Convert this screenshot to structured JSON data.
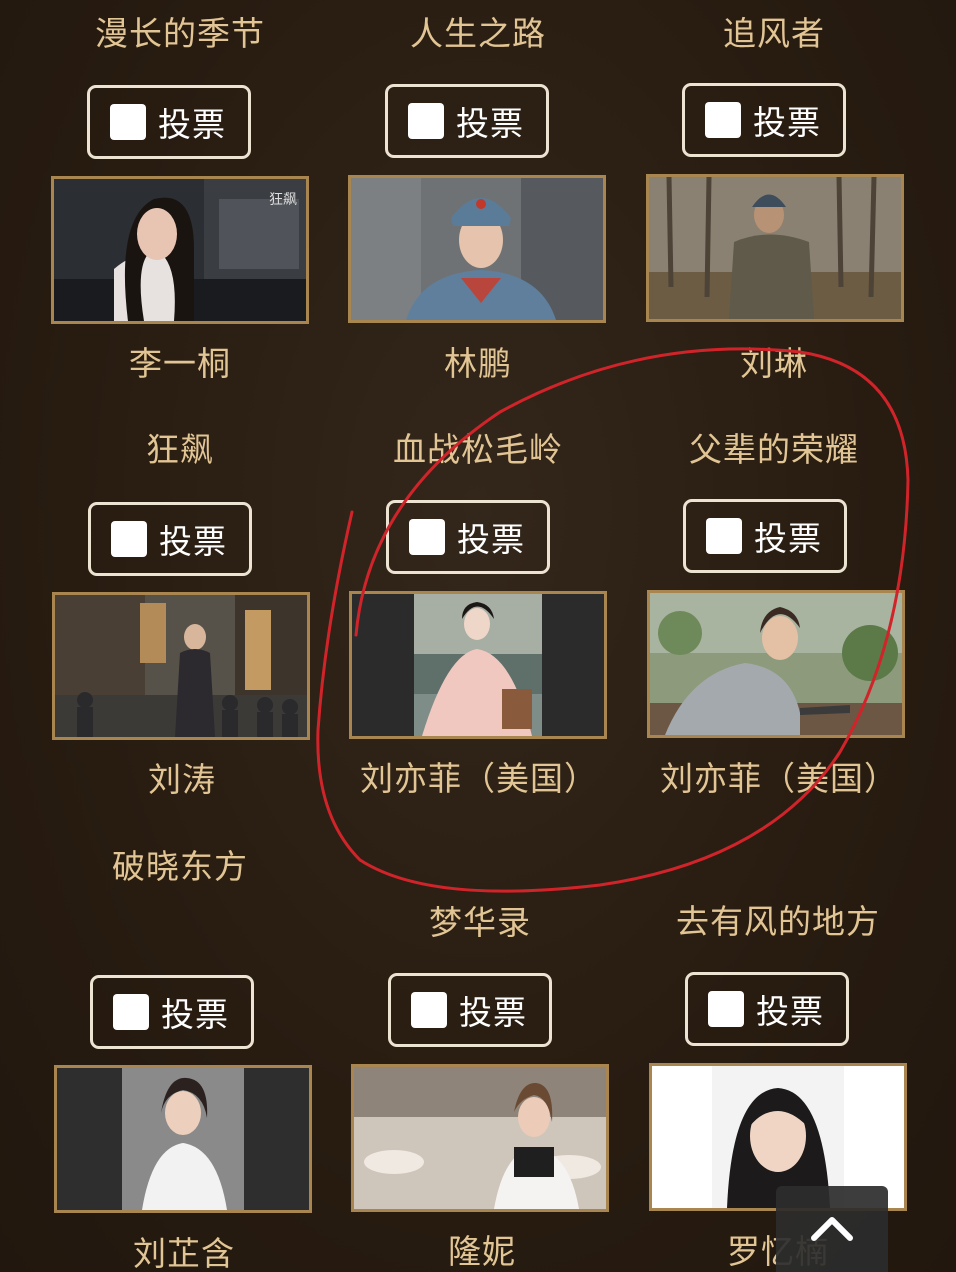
{
  "vote_label": "投票",
  "rows": [
    {
      "titles": [
        "漫长的季节",
        "人生之路",
        "追风者"
      ],
      "names": [
        "李一桐",
        "林鹏",
        "刘琳"
      ]
    },
    {
      "titles": [
        "狂飙",
        "血战松毛岭",
        "父辈的荣耀"
      ],
      "names": [
        "刘涛",
        "刘亦菲（美国）",
        "刘亦菲（美国）"
      ]
    },
    {
      "titles": [
        "破晓东方",
        "梦华录",
        "去有风的地方"
      ],
      "names": [
        "刘芷含",
        "隆妮",
        "罗忆楠"
      ]
    }
  ],
  "photo_watermark": "狂飙",
  "scroll_top_icon": "chevron-up-icon",
  "annotation_color": "#d0242a",
  "photo_frame_color": "#a9864f",
  "text_color": "#e2c594"
}
